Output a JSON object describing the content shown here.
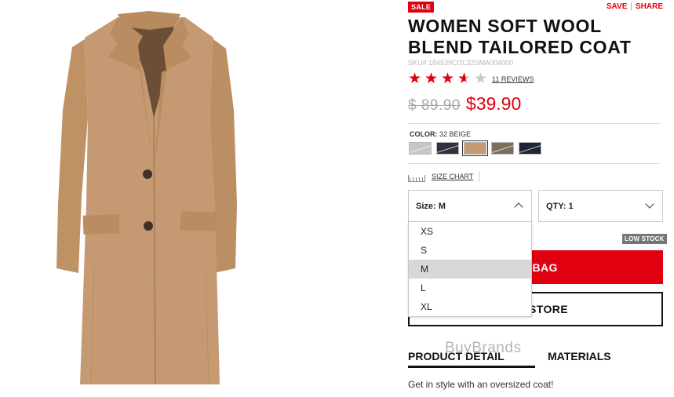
{
  "product": {
    "badge": "SALE",
    "title": "WOMEN SOFT WOOL BLEND TAILORED COAT",
    "sku": "SKU# 184539COL32SMA004000",
    "rating": 3.5,
    "reviews_label": "11 REVIEWS",
    "old_price": "$ 89.90",
    "new_price": "$39.90",
    "description": "Get in style with an oversized coat!"
  },
  "top_links": {
    "save": "SAVE",
    "share": "SHARE"
  },
  "color": {
    "label": "COLOR:",
    "selected": "32 BEIGE",
    "swatches": [
      {
        "name": "light gray",
        "hex": "#c6c6c4"
      },
      {
        "name": "dark navy",
        "hex": "#2d323b"
      },
      {
        "name": "beige",
        "hex": "#c59a72"
      },
      {
        "name": "olive brown",
        "hex": "#7b6e5d"
      },
      {
        "name": "navy",
        "hex": "#1f2535"
      }
    ]
  },
  "size_chart": {
    "label": "SIZE CHART"
  },
  "size_select": {
    "label": "Size: M",
    "options": [
      "XS",
      "S",
      "M",
      "L",
      "XL"
    ],
    "selected": "M"
  },
  "qty_select": {
    "label": "QTY: 1"
  },
  "stock_badge": "LOW STOCK",
  "buttons": {
    "add_to_bag": "TO BAG",
    "find_in_store": "IN STORE"
  },
  "tabs": {
    "product_detail": "PRODUCT DETAIL",
    "materials": "MATERIALS"
  },
  "watermark": "BuyBrands",
  "colors": {
    "accent": "#e0000f",
    "coat": "#c59a72"
  }
}
